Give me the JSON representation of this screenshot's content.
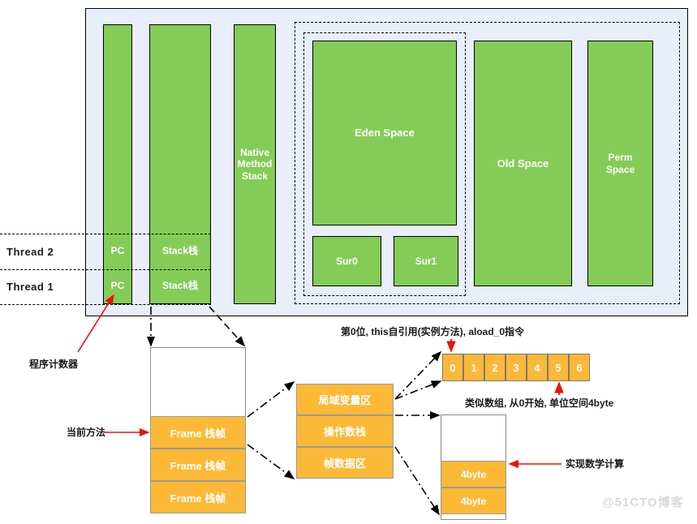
{
  "runtime": {
    "thread_columns": [
      {
        "name": "pc-register-column",
        "cells": [
          "PC",
          "PC"
        ]
      },
      {
        "name": "jvm-stack-column",
        "cells": [
          "Stack栈",
          "Stack栈"
        ]
      }
    ],
    "native_method_stack": "Native\nMethod\nStack",
    "native_method_stack_lines": [
      "Native",
      "Method",
      "Stack"
    ],
    "heap": {
      "young": {
        "eden": "Eden Space",
        "survivors": [
          "Sur0",
          "Sur1"
        ]
      },
      "old": "Old  Space",
      "perm_lines": [
        "Perm",
        "Space"
      ],
      "perm": "Perm Space"
    },
    "threads": [
      {
        "label": "Thread  2"
      },
      {
        "label": "Thread  1"
      }
    ]
  },
  "annotations": {
    "program_counter": "程序计数器",
    "current_method": "当前方法",
    "slot_zero": "第0位, this自引用(实例方法), aload_0指令",
    "array_like": "类似数组, 从0开始, 单位空间4byte",
    "math_calc": "实现数学计算"
  },
  "stack_frames": {
    "frames": [
      "Frame  栈帧",
      "Frame  栈帧",
      "Frame  栈帧"
    ]
  },
  "frame_detail": {
    "sections": [
      "局域变量区",
      "操作数栈",
      "帧数据区"
    ]
  },
  "local_var_array": {
    "indices": [
      "0",
      "1",
      "2",
      "3",
      "4",
      "5",
      "6"
    ]
  },
  "operand_stack": {
    "slots": [
      "4byte",
      "4byte"
    ]
  },
  "watermark": "@51CTO博客",
  "colors": {
    "green": "#84cc57",
    "orange": "#fbb937",
    "panel": "#e8eefa",
    "red_arrow": "#e8120a",
    "outline": "#000000"
  }
}
